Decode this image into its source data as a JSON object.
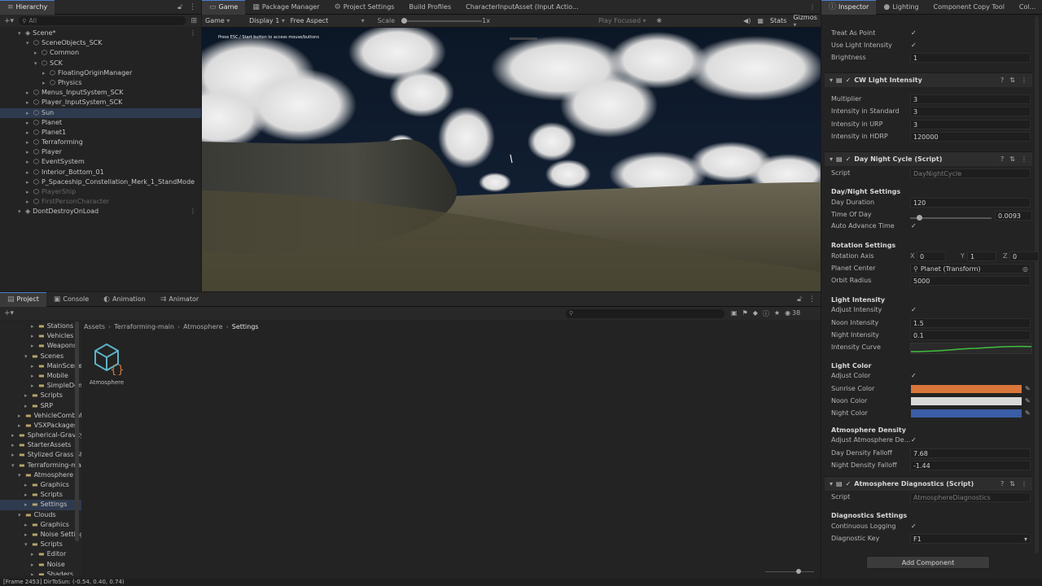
{
  "hierarchy": {
    "tab": "Hierarchy",
    "search_placeholder": "All",
    "items": [
      {
        "label": "Scene*",
        "depth": 0
      },
      {
        "label": "SceneObjects_SCK",
        "depth": 1
      },
      {
        "label": "Common",
        "depth": 2
      },
      {
        "label": "SCK",
        "depth": 2
      },
      {
        "label": "FloatingOriginManager",
        "depth": 3
      },
      {
        "label": "Physics",
        "depth": 3
      },
      {
        "label": "Menus_InputSystem_SCK",
        "depth": 1
      },
      {
        "label": "Player_InputSystem_SCK",
        "depth": 1
      },
      {
        "label": "Sun",
        "depth": 1
      },
      {
        "label": "Planet",
        "depth": 1
      },
      {
        "label": "Planet1",
        "depth": 1
      },
      {
        "label": "Terraforming",
        "depth": 1
      },
      {
        "label": "Player",
        "depth": 1
      },
      {
        "label": "EventSystem",
        "depth": 1
      },
      {
        "label": "Interior_Bottom_01",
        "depth": 1
      },
      {
        "label": "P_Spaceship_Constellation_Merk_1_StandMode",
        "depth": 1
      },
      {
        "label": "PlayerShip",
        "depth": 1
      },
      {
        "label": "FirstPersonCharacter",
        "depth": 1
      },
      {
        "label": "DontDestroyOnLoad",
        "depth": 0
      }
    ]
  },
  "center_tabs": [
    "Game",
    "Package Manager",
    "Project Settings",
    "Build Profiles",
    "CharacterInputAsset (Input Actio..."
  ],
  "game_toolbar": {
    "mode": "Game",
    "display": "Display 1",
    "aspect": "Free Aspect",
    "scale_label": "Scale",
    "scale_value": "1x",
    "play_focused": "Play Focused",
    "stats": "Stats",
    "gizmos": "Gizmos"
  },
  "game_view": {
    "overlay_text": "Press ESC / Start button to access mouse/buttons"
  },
  "bottom_tabs": [
    "Project",
    "Console",
    "Animation",
    "Animator"
  ],
  "project": {
    "count_badge": "38",
    "breadcrumb": [
      "Assets",
      "Terraforming-main",
      "Atmosphere",
      "Settings"
    ],
    "tree": [
      {
        "label": "Stations",
        "depth": 3
      },
      {
        "label": "Vehicles",
        "depth": 3
      },
      {
        "label": "Weapons",
        "depth": 3
      },
      {
        "label": "Scenes",
        "depth": 2
      },
      {
        "label": "MainScenes",
        "depth": 3
      },
      {
        "label": "Mobile",
        "depth": 3
      },
      {
        "label": "SimpleDemos",
        "depth": 3
      },
      {
        "label": "Scripts",
        "depth": 2
      },
      {
        "label": "SRP",
        "depth": 2
      },
      {
        "label": "VehicleCombat",
        "depth": 1
      },
      {
        "label": "VSXPackages",
        "depth": 1
      },
      {
        "label": "Spherical-Gravity",
        "depth": 0
      },
      {
        "label": "StarterAssets",
        "depth": 0
      },
      {
        "label": "Stylized Grass Shader",
        "depth": 0
      },
      {
        "label": "Terraforming-main",
        "depth": 0
      },
      {
        "label": "Atmosphere",
        "depth": 1
      },
      {
        "label": "Graphics",
        "depth": 2
      },
      {
        "label": "Scripts",
        "depth": 2
      },
      {
        "label": "Settings",
        "depth": 2
      },
      {
        "label": "Clouds",
        "depth": 1
      },
      {
        "label": "Graphics",
        "depth": 2
      },
      {
        "label": "Noise Settings",
        "depth": 2
      },
      {
        "label": "Scripts",
        "depth": 2
      },
      {
        "label": "Editor",
        "depth": 3
      },
      {
        "label": "Noise",
        "depth": 3
      },
      {
        "label": "Shaders",
        "depth": 3
      }
    ],
    "asset_name": "Atmosphere"
  },
  "status_bar": "[Frame 2453] DirToSun: (-0.54, 0.40, 0.74)",
  "inspector": {
    "tabs": [
      "Inspector",
      "Lighting",
      "Component Copy Tool",
      "Col..."
    ],
    "top_rows": [
      {
        "label": "Treat As Point",
        "type": "check"
      },
      {
        "label": "Use Light Intensity",
        "type": "check"
      },
      {
        "label": "Brightness",
        "type": "value",
        "value": "1"
      }
    ],
    "cw_light": {
      "title": "CW Light Intensity",
      "rows": [
        {
          "label": "Multiplier",
          "value": "3"
        },
        {
          "label": "Intensity in Standard",
          "value": "3"
        },
        {
          "label": "Intensity in URP",
          "value": "3"
        },
        {
          "label": "Intensity in HDRP",
          "value": "120000"
        }
      ]
    },
    "day_night": {
      "title": "Day Night Cycle (Script)",
      "script_label": "Script",
      "script_value": "DayNightCycle",
      "settings_header": "Day/Night Settings",
      "day_duration_label": "Day Duration",
      "day_duration": "120",
      "time_of_day_label": "Time Of Day",
      "time_of_day": "0.0093",
      "time_of_day_fraction": 0.0093,
      "auto_advance_label": "Auto Advance Time",
      "rotation_header": "Rotation Settings",
      "rotation_axis_label": "Rotation Axis",
      "rotation_axis": {
        "x": "0",
        "y": "1",
        "z": "0"
      },
      "planet_center_label": "Planet Center",
      "planet_center": "Planet (Transform)",
      "orbit_radius_label": "Orbit Radius",
      "orbit_radius": "5000",
      "light_intensity_header": "Light Intensity",
      "adjust_intensity_label": "Adjust Intensity",
      "noon_intensity_label": "Noon Intensity",
      "noon_intensity": "1.5",
      "night_intensity_label": "Night Intensity",
      "night_intensity": "0.1",
      "intensity_curve_label": "Intensity Curve",
      "light_color_header": "Light Color",
      "adjust_color_label": "Adjust Color",
      "sunrise_color_label": "Sunrise Color",
      "sunrise_color": "#d9763a",
      "noon_color_label": "Noon Color",
      "noon_color": "#d9d9d9",
      "night_color_label": "Night Color",
      "night_color": "#3b5da6",
      "atmosphere_header": "Atmosphere Density",
      "adjust_atmo_label": "Adjust Atmosphere De...",
      "day_density_label": "Day Density Falloff",
      "day_density": "7.68",
      "night_density_label": "Night Density Falloff",
      "night_density": "-1.44"
    },
    "diagnostics": {
      "title": "Atmosphere Diagnostics (Script)",
      "script_label": "Script",
      "script_value": "AtmosphereDiagnostics",
      "header": "Diagnostics Settings",
      "continuous_label": "Continuous Logging",
      "key_label": "Diagnostic Key",
      "key_value": "F1"
    },
    "add_component": "Add Component"
  }
}
